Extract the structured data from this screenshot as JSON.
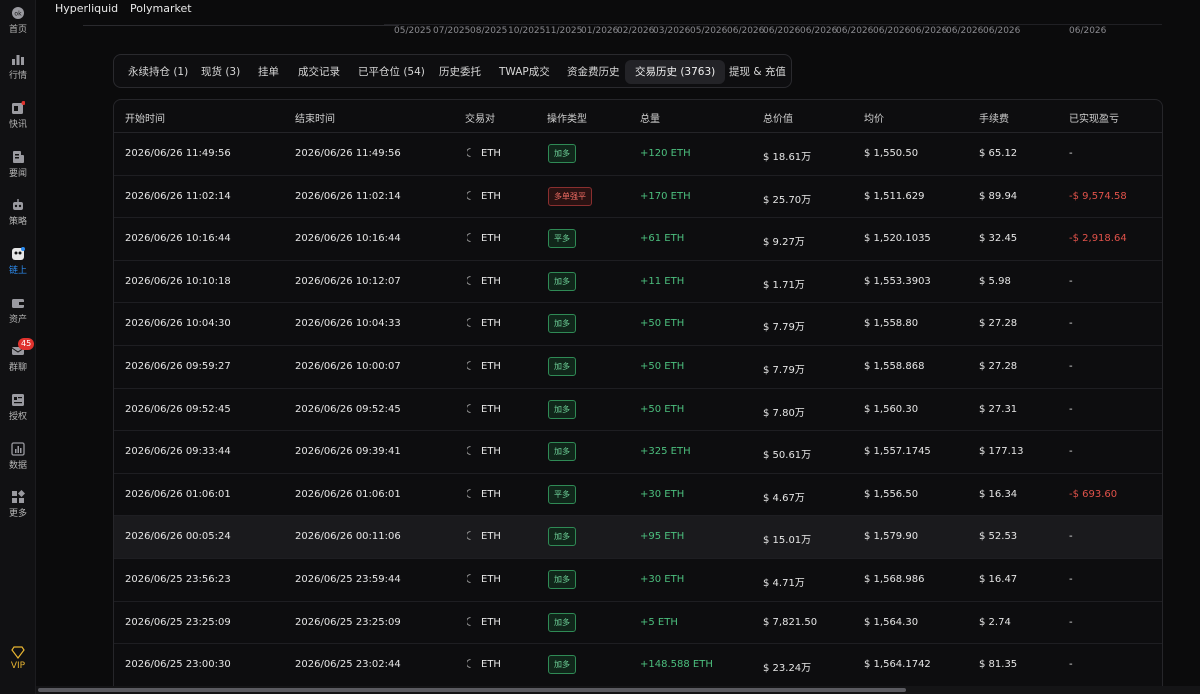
{
  "sidebar": {
    "items": [
      {
        "label": "首页",
        "icon": "home-icon"
      },
      {
        "label": "行情",
        "icon": "market-chart-icon"
      },
      {
        "label": "快讯",
        "icon": "flash-news-icon"
      },
      {
        "label": "要闻",
        "icon": "news-icon"
      },
      {
        "label": "策略",
        "icon": "robot-icon"
      },
      {
        "label": "链上",
        "icon": "onchain-icon"
      },
      {
        "label": "资产",
        "icon": "wallet-icon"
      },
      {
        "label": "群聊",
        "icon": "chat-icon",
        "badge": "45"
      },
      {
        "label": "授权",
        "icon": "authorize-icon"
      },
      {
        "label": "数据",
        "icon": "data-icon"
      },
      {
        "label": "更多",
        "icon": "more-grid-icon"
      }
    ],
    "vip": {
      "label": "VIP",
      "icon": "diamond-icon"
    }
  },
  "topbar": {
    "tabs": [
      "Hyperliquid",
      "Polymarket"
    ],
    "date_ticks": [
      "05/2025",
      "07/2025",
      "08/2025",
      "10/2025",
      "11/2025",
      "01/2026",
      "02/2026",
      "03/2026",
      "05/2026",
      "06/2026",
      "06/2026",
      "06/2026",
      "06/2026",
      "06/2026",
      "06/2026",
      "06/2026",
      "06/2026",
      "06/2026"
    ]
  },
  "tabs": [
    {
      "label": "永续持仓 (1)"
    },
    {
      "label": "现货 (3)"
    },
    {
      "label": "挂单"
    },
    {
      "label": "成交记录"
    },
    {
      "label": "已平仓位 (54)"
    },
    {
      "label": "历史委托"
    },
    {
      "label": "TWAP成交"
    },
    {
      "label": "资金费历史"
    },
    {
      "label": "交易历史 (3763)",
      "active": true
    },
    {
      "label": "提现 & 充值"
    }
  ],
  "table": {
    "headers": [
      "开始时间",
      "结束时间",
      "交易对",
      "操作类型",
      "总量",
      "总价值",
      "均价",
      "手续费",
      "已实现盈亏"
    ],
    "rows": [
      {
        "start": "2026/06/26 11:49:56",
        "end": "2026/06/26 11:49:56",
        "pair": "ETH",
        "action": "加多",
        "action_kind": "g",
        "amount": "+120 ETH",
        "value": "$ 18.61万",
        "avg": "$ 1,550.50",
        "fee": "$ 65.12",
        "pnl": "-",
        "pnl_kind": ""
      },
      {
        "start": "2026/06/26 11:02:14",
        "end": "2026/06/26 11:02:14",
        "pair": "ETH",
        "action": "多单强平",
        "action_kind": "r",
        "amount": "+170 ETH",
        "value": "$ 25.70万",
        "avg": "$ 1,511.629",
        "fee": "$ 89.94",
        "pnl": "-$ 9,574.58",
        "pnl_kind": "red"
      },
      {
        "start": "2026/06/26 10:16:44",
        "end": "2026/06/26 10:16:44",
        "pair": "ETH",
        "action": "平多",
        "action_kind": "g",
        "amount": "+61 ETH",
        "value": "$ 9.27万",
        "avg": "$ 1,520.1035",
        "fee": "$ 32.45",
        "pnl": "-$ 2,918.64",
        "pnl_kind": "red"
      },
      {
        "start": "2026/06/26 10:10:18",
        "end": "2026/06/26 10:12:07",
        "pair": "ETH",
        "action": "加多",
        "action_kind": "g",
        "amount": "+11 ETH",
        "value": "$ 1.71万",
        "avg": "$ 1,553.3903",
        "fee": "$ 5.98",
        "pnl": "-",
        "pnl_kind": ""
      },
      {
        "start": "2026/06/26 10:04:30",
        "end": "2026/06/26 10:04:33",
        "pair": "ETH",
        "action": "加多",
        "action_kind": "g",
        "amount": "+50 ETH",
        "value": "$ 7.79万",
        "avg": "$ 1,558.80",
        "fee": "$ 27.28",
        "pnl": "-",
        "pnl_kind": ""
      },
      {
        "start": "2026/06/26 09:59:27",
        "end": "2026/06/26 10:00:07",
        "pair": "ETH",
        "action": "加多",
        "action_kind": "g",
        "amount": "+50 ETH",
        "value": "$ 7.79万",
        "avg": "$ 1,558.868",
        "fee": "$ 27.28",
        "pnl": "-",
        "pnl_kind": ""
      },
      {
        "start": "2026/06/26 09:52:45",
        "end": "2026/06/26 09:52:45",
        "pair": "ETH",
        "action": "加多",
        "action_kind": "g",
        "amount": "+50 ETH",
        "value": "$ 7.80万",
        "avg": "$ 1,560.30",
        "fee": "$ 27.31",
        "pnl": "-",
        "pnl_kind": ""
      },
      {
        "start": "2026/06/26 09:33:44",
        "end": "2026/06/26 09:39:41",
        "pair": "ETH",
        "action": "加多",
        "action_kind": "g",
        "amount": "+325 ETH",
        "value": "$ 50.61万",
        "avg": "$ 1,557.1745",
        "fee": "$ 177.13",
        "pnl": "-",
        "pnl_kind": ""
      },
      {
        "start": "2026/06/26 01:06:01",
        "end": "2026/06/26 01:06:01",
        "pair": "ETH",
        "action": "平多",
        "action_kind": "g",
        "amount": "+30 ETH",
        "value": "$ 4.67万",
        "avg": "$ 1,556.50",
        "fee": "$ 16.34",
        "pnl": "-$ 693.60",
        "pnl_kind": "red"
      },
      {
        "start": "2026/06/26 00:05:24",
        "end": "2026/06/26 00:11:06",
        "pair": "ETH",
        "action": "加多",
        "action_kind": "g",
        "amount": "+95 ETH",
        "value": "$ 15.01万",
        "avg": "$ 1,579.90",
        "fee": "$ 52.53",
        "pnl": "-",
        "pnl_kind": "",
        "highlight": true
      },
      {
        "start": "2026/06/25 23:56:23",
        "end": "2026/06/25 23:59:44",
        "pair": "ETH",
        "action": "加多",
        "action_kind": "g",
        "amount": "+30 ETH",
        "value": "$ 4.71万",
        "avg": "$ 1,568.986",
        "fee": "$ 16.47",
        "pnl": "-",
        "pnl_kind": ""
      },
      {
        "start": "2026/06/25 23:25:09",
        "end": "2026/06/25 23:25:09",
        "pair": "ETH",
        "action": "加多",
        "action_kind": "g",
        "amount": "+5 ETH",
        "value": "$ 7,821.50",
        "avg": "$ 1,564.30",
        "fee": "$ 2.74",
        "pnl": "-",
        "pnl_kind": ""
      },
      {
        "start": "2026/06/25 23:00:30",
        "end": "2026/06/25 23:02:44",
        "pair": "ETH",
        "action": "加多",
        "action_kind": "g",
        "amount": "+148.588 ETH",
        "value": "$ 23.24万",
        "avg": "$ 1,564.1742",
        "fee": "$ 81.35",
        "pnl": "-",
        "pnl_kind": ""
      }
    ]
  },
  "colors": {
    "accent_green": "#4cbf7e",
    "accent_red": "#e0524a",
    "active_blue": "#2d8cf0",
    "vip_gold": "#e8b532"
  }
}
